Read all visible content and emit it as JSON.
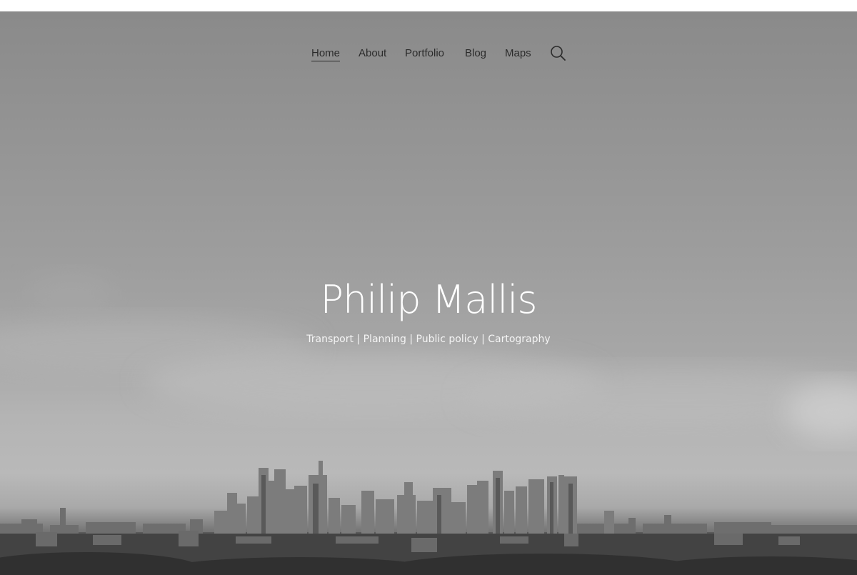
{
  "nav": {
    "items": [
      {
        "label": "Home",
        "active": true
      },
      {
        "label": "About",
        "active": false
      },
      {
        "label": "Portfolio",
        "active": false
      },
      {
        "label": "Blog",
        "active": false
      },
      {
        "label": "Maps",
        "active": false
      }
    ],
    "search_icon": "search-icon"
  },
  "hero": {
    "title": "Philip Mallis",
    "tagline": "Transport | Planning | Public policy | Cartography",
    "background": "grayscale city skyline photo"
  },
  "colors": {
    "nav_text": "#2b2b2b",
    "title_text": "#ffffff"
  }
}
